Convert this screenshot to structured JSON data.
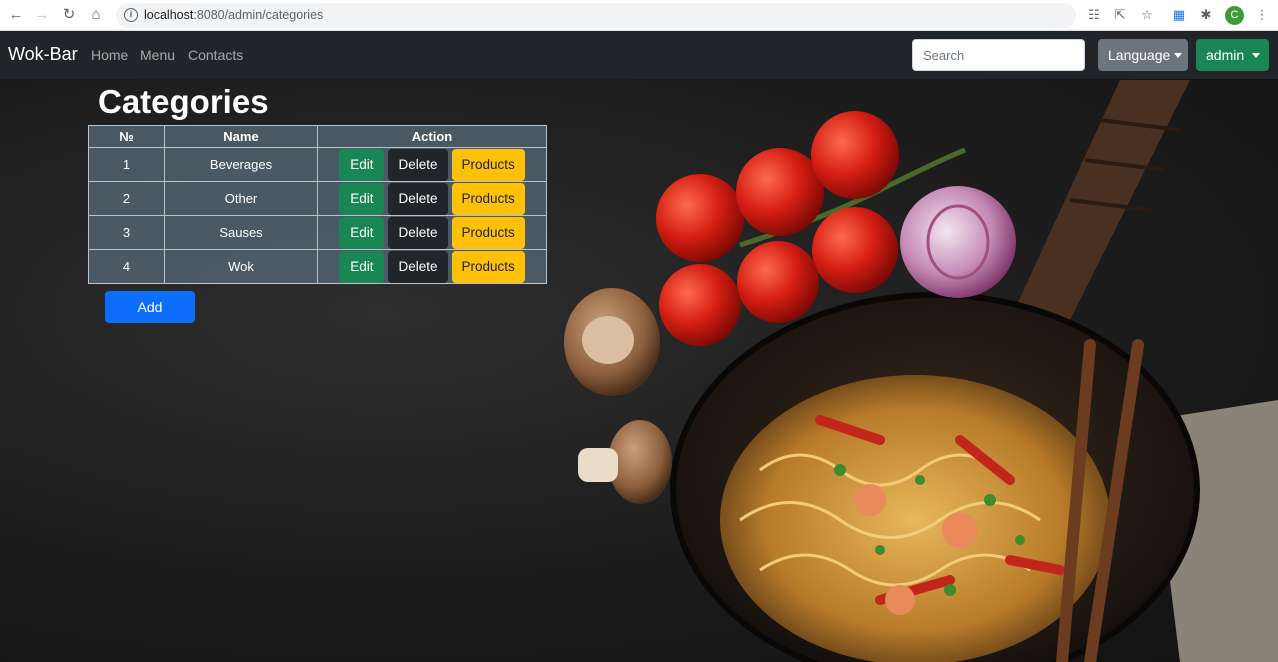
{
  "browser": {
    "url_host": "localhost",
    "url_path": ":8080/admin/categories",
    "profile_initial": "C"
  },
  "navbar": {
    "brand": "Wok-Bar",
    "links": [
      "Home",
      "Menu",
      "Contacts"
    ],
    "search_placeholder": "Search",
    "language_label": "Language",
    "admin_label": "admin"
  },
  "page": {
    "title": "Categories",
    "add_label": "Add"
  },
  "table": {
    "headers": [
      "№",
      "Name",
      "Action"
    ],
    "rows": [
      {
        "num": "1",
        "name": "Beverages"
      },
      {
        "num": "2",
        "name": "Other"
      },
      {
        "num": "3",
        "name": "Sauses"
      },
      {
        "num": "4",
        "name": "Wok"
      }
    ],
    "actions": {
      "edit": "Edit",
      "delete": "Delete",
      "products": "Products"
    }
  },
  "colors": {
    "navbar": "#212529",
    "edit": "#198754",
    "delete": "#212529",
    "products": "#ffc107",
    "add": "#0d6efd",
    "language": "#6c757d",
    "admin": "#198754"
  }
}
